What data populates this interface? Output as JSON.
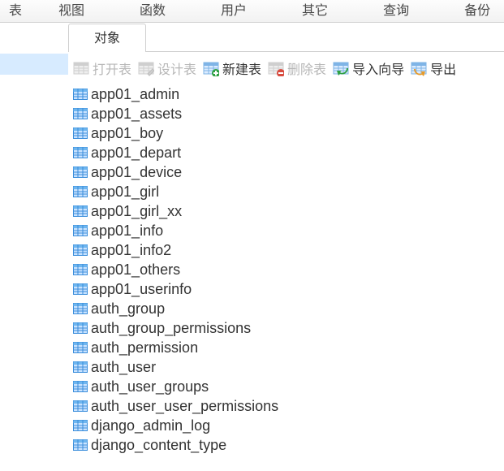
{
  "menu": {
    "items": [
      "表",
      "视图",
      "函数",
      "用户",
      "其它",
      "查询",
      "备份"
    ],
    "leftOffsets": [
      0,
      66,
      160,
      254,
      345,
      438,
      530
    ]
  },
  "tabs": {
    "items": [
      {
        "label": "对象"
      }
    ],
    "activeIndex": 0
  },
  "toolbar": {
    "open": {
      "label": "打开表"
    },
    "design": {
      "label": "设计表"
    },
    "new": {
      "label": "新建表"
    },
    "delete": {
      "label": "删除表"
    },
    "import": {
      "label": "导入向导"
    },
    "export": {
      "label": "导出"
    }
  },
  "icons": {
    "badge_plus_color": "#2ea043",
    "badge_minus_color": "#d84b3f",
    "arrow_import_color": "#2ea043",
    "arrow_export_color": "#e89b2a"
  },
  "tables": [
    "app01_admin",
    "app01_assets",
    "app01_boy",
    "app01_depart",
    "app01_device",
    "app01_girl",
    "app01_girl_xx",
    "app01_info",
    "app01_info2",
    "app01_others",
    "app01_userinfo",
    "auth_group",
    "auth_group_permissions",
    "auth_permission",
    "auth_user",
    "auth_user_groups",
    "auth_user_user_permissions",
    "django_admin_log",
    "django_content_type"
  ]
}
